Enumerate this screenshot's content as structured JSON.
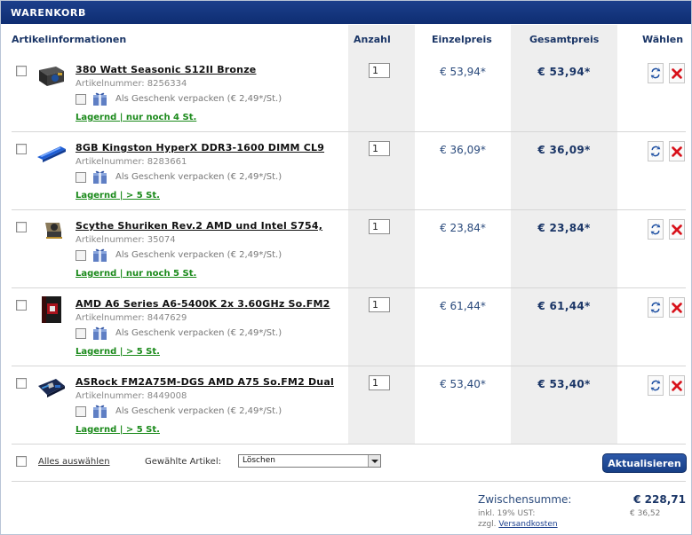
{
  "window": {
    "title": "WARENKORB"
  },
  "columns": {
    "article_info": "Artikelinformationen",
    "quantity": "Anzahl",
    "unit_price": "Einzelpreis",
    "total_price": "Gesamtpreis",
    "choose": "Wählen"
  },
  "items": [
    {
      "name": "380 Watt Seasonic S12II Bronze",
      "article_number": "Artikelnummer: 8256334",
      "gift_label": "Als Geschenk verpacken (€ 2,49*/St.)",
      "stock": "Lagernd | nur noch 4 St.",
      "quantity": "1",
      "unit_price": "€ 53,94*",
      "total_price": "€ 53,94*",
      "thumb_icon": "psu-icon"
    },
    {
      "name": "8GB Kingston HyperX DDR3-1600 DIMM CL9",
      "article_number": "Artikelnummer: 8283661",
      "gift_label": "Als Geschenk verpacken (€ 2,49*/St.)",
      "stock": "Lagernd | > 5 St.",
      "quantity": "1",
      "unit_price": "€ 36,09*",
      "total_price": "€ 36,09*",
      "thumb_icon": "ram-icon"
    },
    {
      "name": "Scythe Shuriken Rev.2 AMD und Intel S754,",
      "article_number": "Artikelnummer: 35074",
      "gift_label": "Als Geschenk verpacken (€ 2,49*/St.)",
      "stock": "Lagernd | nur noch 5 St.",
      "quantity": "1",
      "unit_price": "€ 23,84*",
      "total_price": "€ 23,84*",
      "thumb_icon": "cooler-icon"
    },
    {
      "name": "AMD A6 Series A6-5400K 2x 3.60GHz So.FM2",
      "article_number": "Artikelnummer: 8447629",
      "gift_label": "Als Geschenk verpacken (€ 2,49*/St.)",
      "stock": "Lagernd | > 5 St.",
      "quantity": "1",
      "unit_price": "€ 61,44*",
      "total_price": "€ 61,44*",
      "thumb_icon": "cpu-box-icon"
    },
    {
      "name": "ASRock FM2A75M-DGS AMD A75 So.FM2 Dual",
      "article_number": "Artikelnummer: 8449008",
      "gift_label": "Als Geschenk verpacken (€ 2,49*/St.)",
      "stock": "Lagernd | > 5 St.",
      "quantity": "1",
      "unit_price": "€ 53,40*",
      "total_price": "€ 53,40*",
      "thumb_icon": "motherboard-icon"
    }
  ],
  "footer": {
    "select_all": "Alles auswählen",
    "selected_label": "Gewählte Artikel:",
    "action_value": "Löschen",
    "update_button": "Aktualisieren",
    "subtotal_label": "Zwischensumme:",
    "subtotal_value": "€ 228,71",
    "vat_label": "inkl. 19% UST:",
    "vat_value": "€ 36,52",
    "shipping_prefix": "zzgl.",
    "shipping_link": "Versandkosten"
  },
  "colors": {
    "header_bar": "#12357d",
    "stock_green": "#1b8a1b",
    "price_blue": "#1a3566",
    "column_shade": "#eeeeee"
  }
}
